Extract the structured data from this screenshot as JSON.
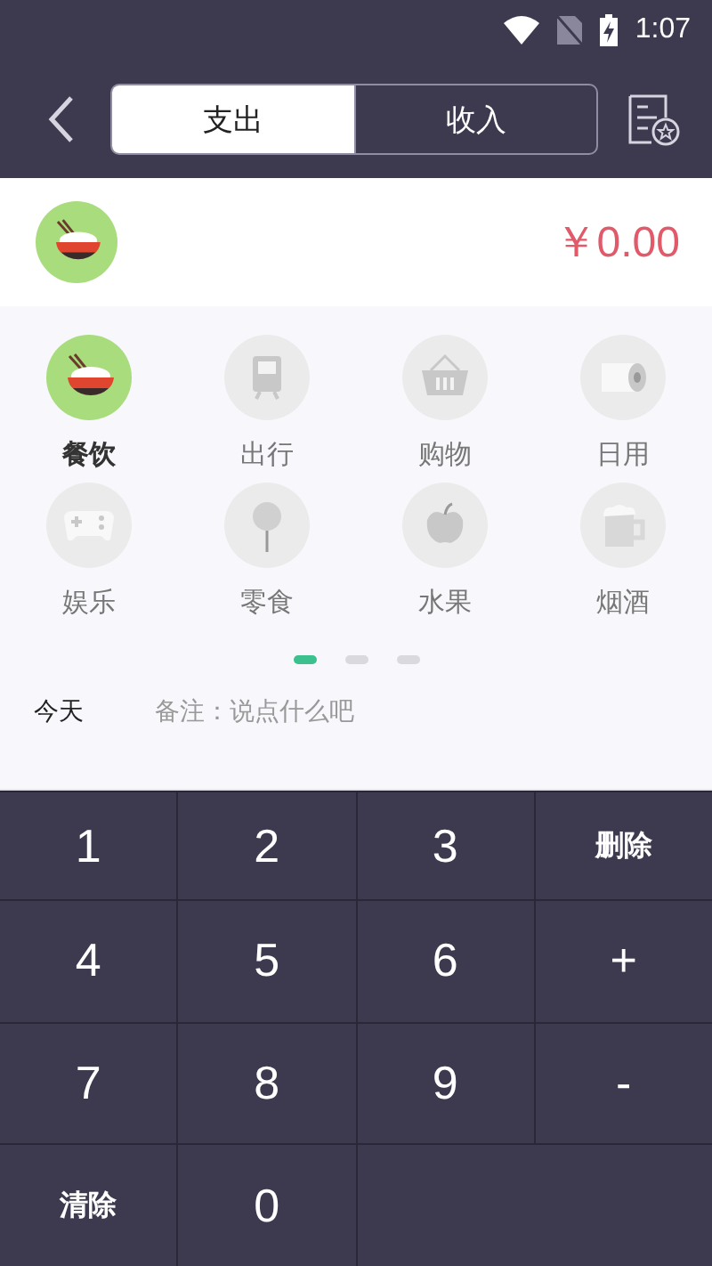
{
  "status_bar": {
    "time": "1:07"
  },
  "tabs": [
    {
      "label": "支出",
      "selected": true
    },
    {
      "label": "收入",
      "selected": false
    }
  ],
  "amount": {
    "kind": "food",
    "value": "￥0.00"
  },
  "categories": [
    {
      "label": "餐饮",
      "kind": "food",
      "selected": true
    },
    {
      "label": "出行",
      "kind": "transit",
      "selected": false
    },
    {
      "label": "购物",
      "kind": "shopping",
      "selected": false
    },
    {
      "label": "日用",
      "kind": "daily",
      "selected": false
    },
    {
      "label": "娱乐",
      "kind": "fun",
      "selected": false
    },
    {
      "label": "零食",
      "kind": "snack",
      "selected": false
    },
    {
      "label": "水果",
      "kind": "fruit",
      "selected": false
    },
    {
      "label": "烟酒",
      "kind": "drink",
      "selected": false
    }
  ],
  "pager": [
    {
      "selected": true
    },
    {
      "selected": false
    },
    {
      "selected": false
    }
  ],
  "date": "今天",
  "note": {
    "placeholder": "备注：说点什么吧"
  },
  "keypad": [
    {
      "label": "1",
      "kind": "digit"
    },
    {
      "label": "2",
      "kind": "digit"
    },
    {
      "label": "3",
      "kind": "digit"
    },
    {
      "label": "删除",
      "kind": "action"
    },
    {
      "label": "4",
      "kind": "digit"
    },
    {
      "label": "5",
      "kind": "digit"
    },
    {
      "label": "6",
      "kind": "digit"
    },
    {
      "label": "+",
      "kind": "digit"
    },
    {
      "label": "7",
      "kind": "digit"
    },
    {
      "label": "8",
      "kind": "digit"
    },
    {
      "label": "9",
      "kind": "digit"
    },
    {
      "label": "-",
      "kind": "digit"
    },
    {
      "label": "清除",
      "kind": "action"
    },
    {
      "label": "0",
      "kind": "digit"
    }
  ]
}
